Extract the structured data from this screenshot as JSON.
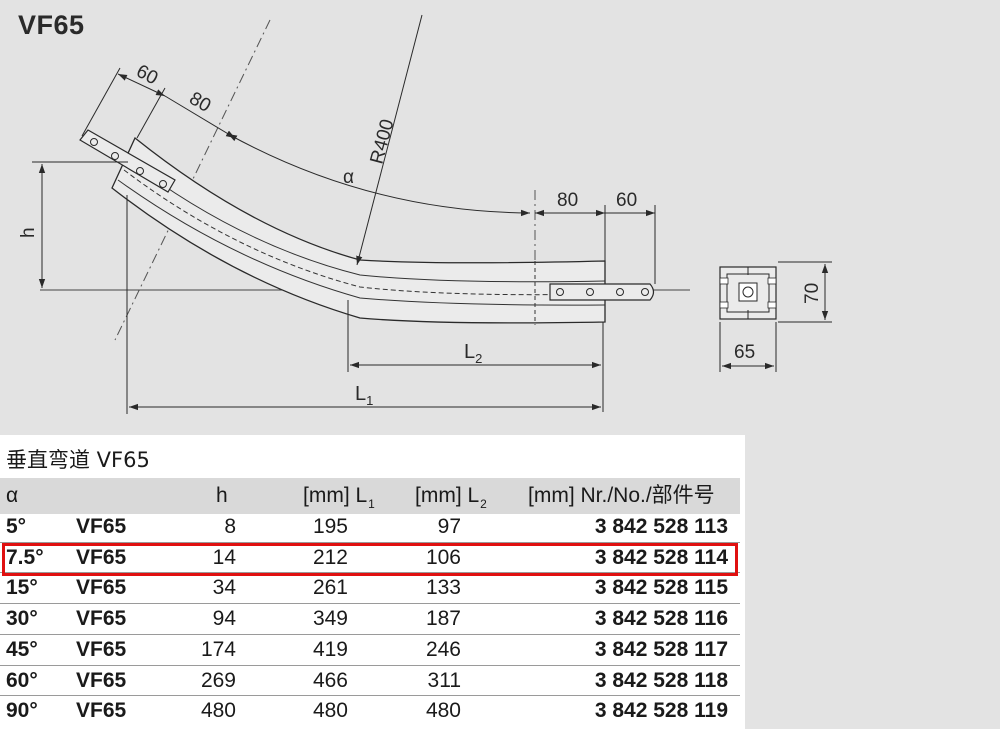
{
  "title": "VF65",
  "drawing": {
    "dim_60_top": "60",
    "dim_80_top": "80",
    "radius": "R400",
    "alpha": "α",
    "h": "h",
    "dim_80_right": "80",
    "dim_60_right": "60",
    "L2": "L",
    "L2_sub": "2",
    "L1": "L",
    "L1_sub": "1",
    "profile_height": "70",
    "profile_width": "65"
  },
  "caption": "垂直弯道 VF65",
  "table": {
    "headers": {
      "alpha": "α",
      "h": "h",
      "L1": "[mm] L",
      "L1_sub": "1",
      "L2": "[mm] L",
      "L2_sub": "2",
      "part_no": "[mm] Nr./No./部件号"
    },
    "rows": [
      {
        "alpha": "5°",
        "model": "VF65",
        "h": "8",
        "L1": "195",
        "L2": "97",
        "part_no": "3 842 528 113"
      },
      {
        "alpha": "7.5°",
        "model": "VF65",
        "h": "14",
        "L1": "212",
        "L2": "106",
        "part_no": "3 842 528 114"
      },
      {
        "alpha": "15°",
        "model": "VF65",
        "h": "34",
        "L1": "261",
        "L2": "133",
        "part_no": "3 842 528 115"
      },
      {
        "alpha": "30°",
        "model": "VF65",
        "h": "94",
        "L1": "349",
        "L2": "187",
        "part_no": "3 842 528 116"
      },
      {
        "alpha": "45°",
        "model": "VF65",
        "h": "174",
        "L1": "419",
        "L2": "246",
        "part_no": "3 842 528 117"
      },
      {
        "alpha": "60°",
        "model": "VF65",
        "h": "269",
        "L1": "466",
        "L2": "311",
        "part_no": "3 842 528 118"
      },
      {
        "alpha": "90°",
        "model": "VF65",
        "h": "480",
        "L1": "480",
        "L2": "480",
        "part_no": "3 842 528 119"
      }
    ],
    "highlight_color": "#e01010"
  }
}
